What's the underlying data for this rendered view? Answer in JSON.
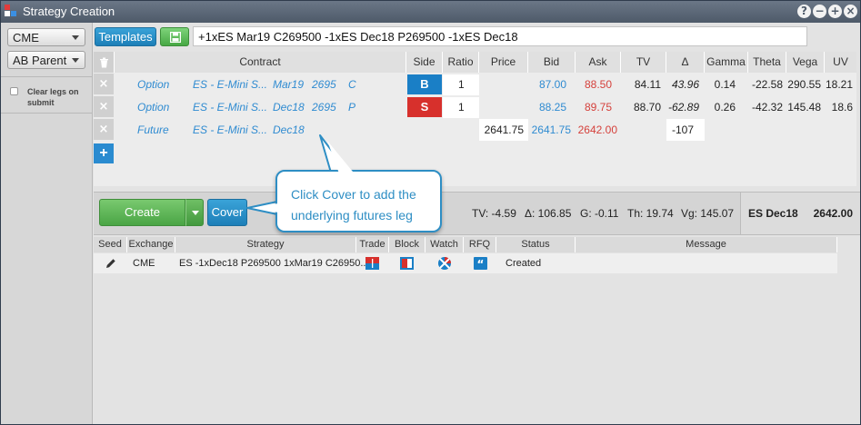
{
  "window": {
    "title": "Strategy Creation"
  },
  "sidebar": {
    "exchange_select": "CME",
    "account_select": "AB Parent",
    "clear_legs_label": "Clear legs on submit"
  },
  "toolbar": {
    "templates_label": "Templates",
    "strategy_text": "+1xES Mar19 C269500 -1xES Dec18 P269500 -1xES Dec18"
  },
  "legs": {
    "headers": [
      "Contract",
      "Side",
      "Ratio",
      "Price",
      "Bid",
      "Ask",
      "TV",
      "Δ",
      "Gamma",
      "Theta",
      "Vega",
      "UV"
    ],
    "rows": [
      {
        "type": "Option",
        "product": "ES - E-Mini S...",
        "expiry": "Mar19",
        "strike": "2695",
        "cp": "C",
        "side": "B",
        "ratio": "1",
        "price": "",
        "bid": "87.00",
        "ask": "88.50",
        "tv": "84.11",
        "delta": "43.96",
        "gamma": "0.14",
        "theta": "-22.58",
        "vega": "290.55",
        "uv": "18.21"
      },
      {
        "type": "Option",
        "product": "ES - E-Mini S...",
        "expiry": "Dec18",
        "strike": "2695",
        "cp": "P",
        "side": "S",
        "ratio": "1",
        "price": "",
        "bid": "88.25",
        "ask": "89.75",
        "tv": "88.70",
        "delta": "-62.89",
        "gamma": "0.26",
        "theta": "-42.32",
        "vega": "145.48",
        "uv": "18.6"
      },
      {
        "type": "Future",
        "product": "ES - E-Mini S...",
        "expiry": "Dec18",
        "strike": "",
        "cp": "",
        "side": "",
        "ratio": "",
        "price": "2641.75",
        "bid": "2641.75",
        "ask": "2642.00",
        "tv": "",
        "delta": "-107",
        "gamma": "",
        "theta": "",
        "vega": "",
        "uv": ""
      }
    ]
  },
  "actions": {
    "create_label": "Create",
    "cover_label": "Cover",
    "tv": "TV: -4.59",
    "delta": "Δ: 106.85",
    "gamma": "G: -0.11",
    "theta": "Th: 19.74",
    "vega": "Vg: 145.07",
    "underlying": "ES Dec18",
    "underlying_price": "2642.00"
  },
  "callout": {
    "line1": "Click Cover to add the",
    "line2": "underlying futures leg"
  },
  "orders": {
    "headers": [
      "Seed",
      "Exchange",
      "Strategy",
      "Trade",
      "Block",
      "Watch",
      "RFQ",
      "Status",
      "Message"
    ],
    "rows": [
      {
        "exchange": "CME",
        "strategy": "ES -1xDec18 P269500 1xMar19 C26950...",
        "status": "Created",
        "message": ""
      }
    ]
  },
  "colors": {
    "accent_blue": "#1d7fb8",
    "buy_blue": "#1a7fc6",
    "sell_red": "#d7302c",
    "create_green": "#4aa545"
  }
}
